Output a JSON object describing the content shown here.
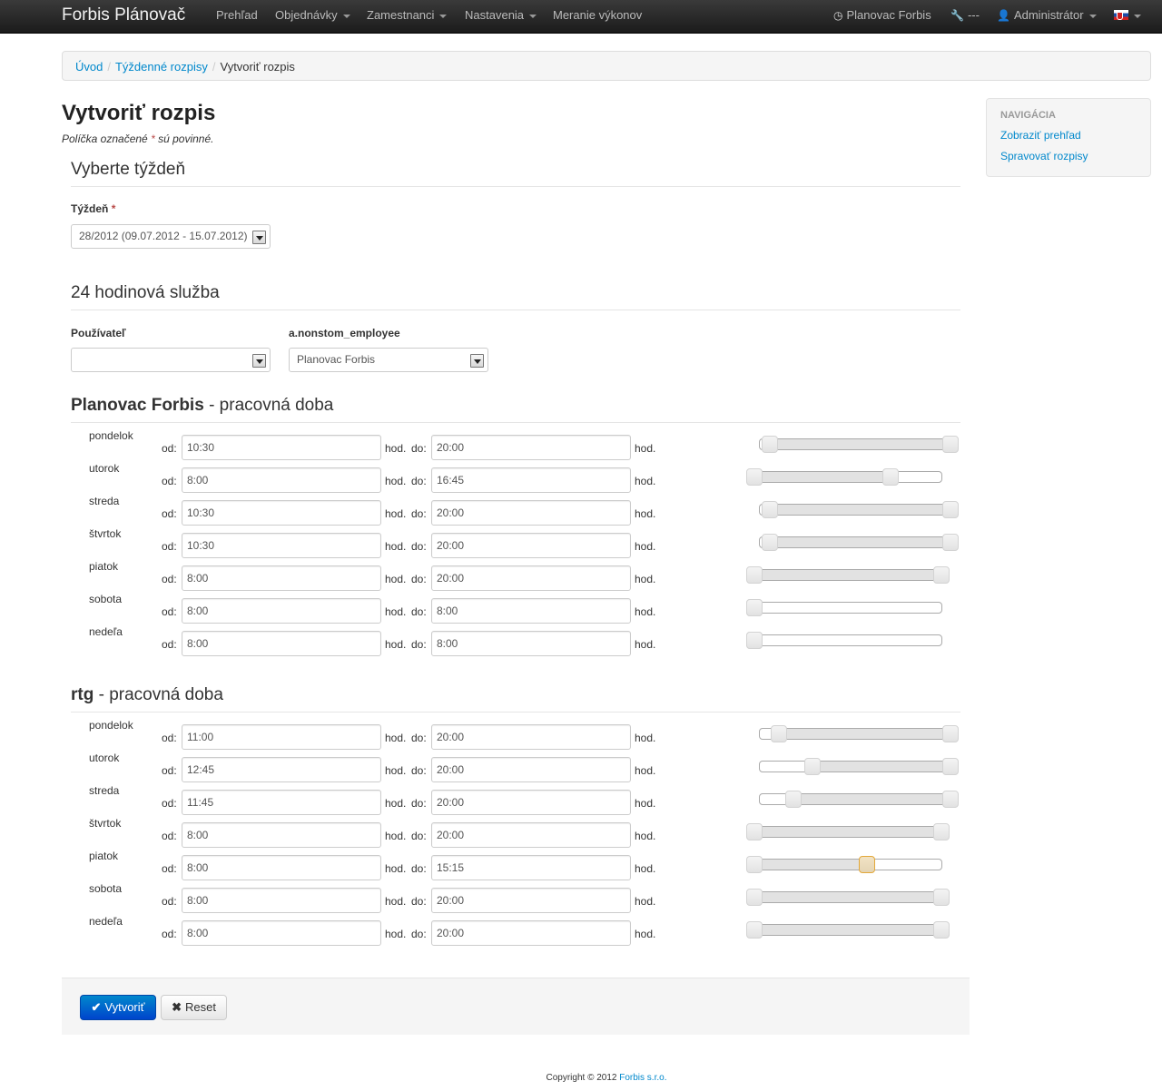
{
  "navbar": {
    "brand": "Forbis Plánovač",
    "items": [
      {
        "label": "Prehľad",
        "dropdown": false
      },
      {
        "label": "Objednávky",
        "dropdown": true
      },
      {
        "label": "Zamestnanci",
        "dropdown": true
      },
      {
        "label": "Nastavenia",
        "dropdown": true
      },
      {
        "label": "Meranie výkonov",
        "dropdown": false
      }
    ],
    "right": {
      "planner": "Planovac Forbis",
      "tools": "---",
      "user": "Administrátor"
    }
  },
  "breadcrumb": {
    "items": [
      "Úvod",
      "Týždenné rozpisy"
    ],
    "current": "Vytvoriť rozpis",
    "separator": "/"
  },
  "page": {
    "title": "Vytvoriť rozpis",
    "required_note_prefix": "Políčka označené",
    "required_mark": "*",
    "required_note_suffix": "sú povinné."
  },
  "week_section": {
    "title": "Vyberte týždeň",
    "label": "Týždeň",
    "value": "28/2012 (09.07.2012 - 15.07.2012)"
  },
  "service_section": {
    "title": "24 hodinová služba",
    "user_label": "Používateľ",
    "user_value": "",
    "employee_label": "a.nonstom_employee",
    "employee_value": "Planovac Forbis"
  },
  "labels": {
    "from": "od:",
    "to": "do:",
    "hours": "hod."
  },
  "schedules": [
    {
      "name": "Planovac Forbis",
      "suffix": "- pracovná doba",
      "days": [
        {
          "day": "pondelok",
          "from": "10:30",
          "to": "20:00"
        },
        {
          "day": "utorok",
          "from": "8:00",
          "to": "16:45"
        },
        {
          "day": "streda",
          "from": "10:30",
          "to": "20:00"
        },
        {
          "day": "štvrtok",
          "from": "10:30",
          "to": "20:00"
        },
        {
          "day": "piatok",
          "from": "8:00",
          "to": "20:00"
        },
        {
          "day": "sobota",
          "from": "8:00",
          "to": "8:00"
        },
        {
          "day": "nedeľa",
          "from": "8:00",
          "to": "8:00"
        }
      ]
    },
    {
      "name": "rtg",
      "suffix": "- pracovná doba",
      "days": [
        {
          "day": "pondelok",
          "from": "11:00",
          "to": "20:00"
        },
        {
          "day": "utorok",
          "from": "12:45",
          "to": "20:00"
        },
        {
          "day": "streda",
          "from": "11:45",
          "to": "20:00"
        },
        {
          "day": "štvrtok",
          "from": "8:00",
          "to": "20:00"
        },
        {
          "day": "piatok",
          "from": "8:00",
          "to": "15:15"
        },
        {
          "day": "sobota",
          "from": "8:00",
          "to": "20:00"
        },
        {
          "day": "nedeľa",
          "from": "8:00",
          "to": "20:00"
        }
      ]
    }
  ],
  "side_nav": {
    "header": "Navigácia",
    "links": [
      "Zobraziť prehľad",
      "Spravovať rozpisy"
    ]
  },
  "actions": {
    "create": "Vytvoriť",
    "reset": "Reset"
  },
  "footer": {
    "prefix": "Copyright © 2012",
    "company": "Forbis s.r.o."
  }
}
